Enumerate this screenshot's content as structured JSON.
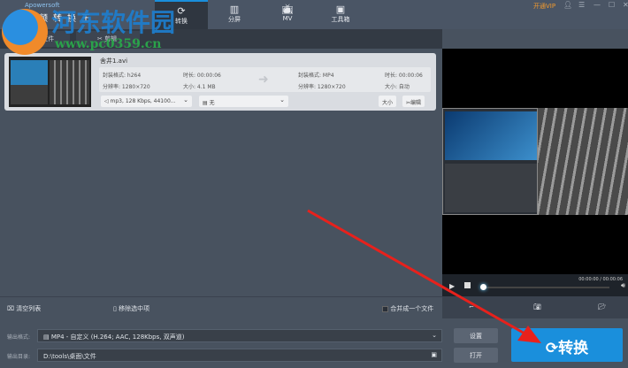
{
  "app": {
    "brand": "Apowersoft",
    "name": "视频转换王",
    "vip": "开通VIP"
  },
  "tabs": [
    {
      "label": "转换",
      "icon": "refresh-icon",
      "active": true
    },
    {
      "label": "分屏",
      "icon": "split-screen-icon"
    },
    {
      "label": "MV",
      "icon": "tv-icon"
    },
    {
      "label": "工具箱",
      "icon": "toolbox-icon"
    }
  ],
  "toolbar": {
    "add_file": "+ 添加文件",
    "edit": "✂ 剪辑"
  },
  "file": {
    "name": "舍井1.avi",
    "src": {
      "codec": "封装格式: h264",
      "res": "分辨率: 1280×720",
      "dur": "时长: 00:00:06",
      "size": "大小: 4.1 MB"
    },
    "dst": {
      "codec": "封装格式: MP4",
      "res": "分辨率: 1280×720",
      "dur": "时长: 00:00:06",
      "size": "大小: 自动"
    },
    "audio": "mp3, 128 Kbps, 44100...",
    "subtitle": "无",
    "size_btn": "大小",
    "edit_btn": "编辑"
  },
  "player": {
    "time": "00:00:00 / 00:00:06",
    "progress": 0
  },
  "bottom": {
    "clear": "清空列表",
    "remove": "移除选中项",
    "merge": "合并成一个文件",
    "merge_checked": false
  },
  "output": {
    "format_label": "输出格式:",
    "format": "MP4 - 自定义 (H.264; AAC, 128Kbps, 双声道)",
    "dir_label": "输出目录:",
    "dir": "D:\\tools\\桌面\\文件",
    "settings": "设置",
    "open": "打开"
  },
  "convert": "转换",
  "watermark": {
    "text": "河东软件园",
    "url": "www.pc0359.cn"
  },
  "colors": {
    "accent": "#1a8fdc",
    "vip": "#f29a2e"
  }
}
